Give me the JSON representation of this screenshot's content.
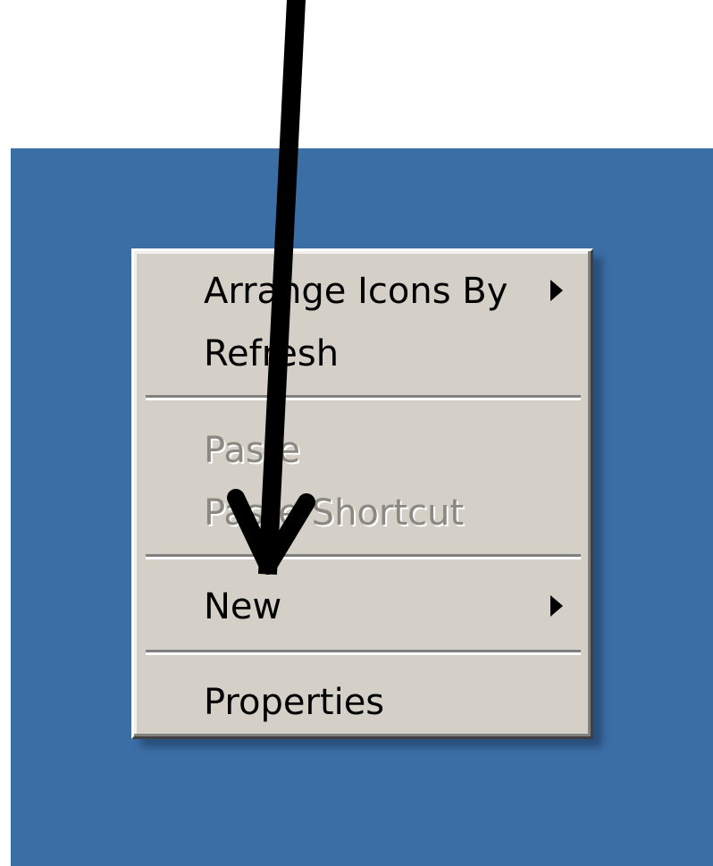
{
  "context_menu": {
    "items": [
      {
        "label": "Arrange Icons By",
        "enabled": true,
        "has_submenu": true
      },
      {
        "label": "Refresh",
        "enabled": true,
        "has_submenu": false
      },
      {
        "label": "Paste",
        "enabled": false,
        "has_submenu": false
      },
      {
        "label": "Paste Shortcut",
        "enabled": false,
        "has_submenu": false
      },
      {
        "label": "New",
        "enabled": true,
        "has_submenu": true
      },
      {
        "label": "Properties",
        "enabled": true,
        "has_submenu": false
      }
    ]
  },
  "colors": {
    "desktop_background": "#3a6ea5",
    "menu_background": "#d4d0c8",
    "disabled_text": "#8b8882",
    "annotation_arrow": "#000000"
  },
  "icons": {
    "submenu": "submenu-arrow-icon",
    "annotation": "annotation-arrow-icon"
  }
}
